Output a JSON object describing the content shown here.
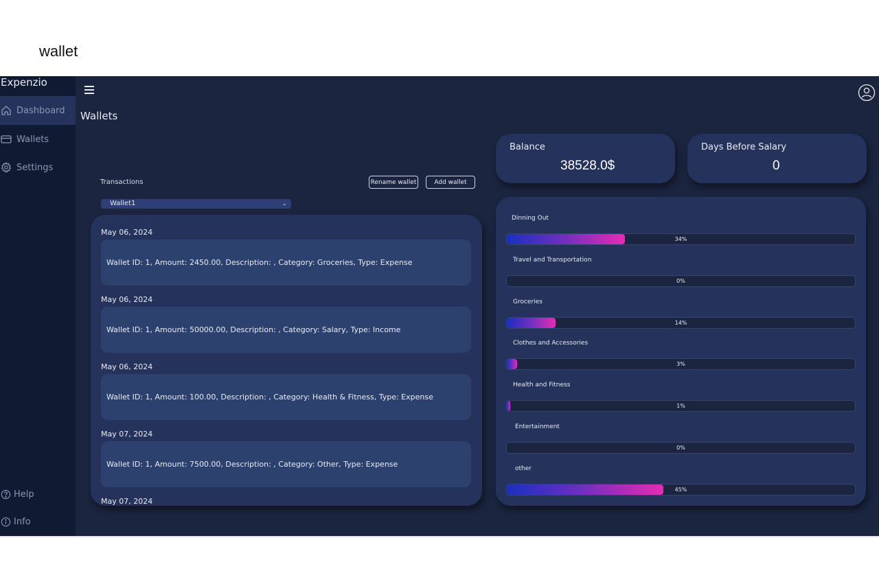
{
  "document": {
    "title": "wallet"
  },
  "app": {
    "brand": "Expenzio",
    "page_title": "Wallets"
  },
  "sidebar": {
    "items": [
      {
        "label": "Dashboard",
        "icon": "home-icon",
        "active": true
      },
      {
        "label": "Wallets",
        "icon": "wallet-icon",
        "active": false
      },
      {
        "label": "Settings",
        "icon": "gear-icon",
        "active": false
      }
    ],
    "footer": [
      {
        "label": "Help",
        "icon": "help-icon"
      },
      {
        "label": "Info",
        "icon": "info-icon"
      }
    ]
  },
  "transactions": {
    "label": "Transactions",
    "rename_button": "Rename wallet",
    "add_button": "Add wallet",
    "wallet_select": "Wallet1",
    "items": [
      {
        "date": "May 06, 2024",
        "text": "Wallet ID: 1, Amount: 2450.00, Description: , Category: Groceries, Type: Expense"
      },
      {
        "date": "May 06, 2024",
        "text": "Wallet ID: 1, Amount: 50000.00, Description: , Category: Salary, Type: Income"
      },
      {
        "date": "May 06, 2024",
        "text": "Wallet ID: 1, Amount: 100.00, Description: , Category: Health & Fitness, Type: Expense"
      },
      {
        "date": "May 07, 2024",
        "text": "Wallet ID: 1, Amount: 7500.00, Description: , Category: Other, Type: Expense"
      },
      {
        "date": "May 07, 2024",
        "text": ""
      }
    ]
  },
  "stats": {
    "balance": {
      "label": "Balance",
      "value": "38528.0$"
    },
    "days_before_salary": {
      "label": "Days Before Salary",
      "value": "0"
    }
  },
  "categories": [
    {
      "name": "Dinning Out",
      "percent": 34,
      "percent_label": "34%"
    },
    {
      "name": "Travel and Transportation",
      "percent": 0,
      "percent_label": "0%"
    },
    {
      "name": "Groceries",
      "percent": 14,
      "percent_label": "14%"
    },
    {
      "name": "Clothes and Accessories",
      "percent": 3,
      "percent_label": "3%"
    },
    {
      "name": "Health  and Fitness",
      "percent": 1,
      "percent_label": "1%"
    },
    {
      "name": "Entertainment",
      "percent": 0,
      "percent_label": "0%"
    },
    {
      "name": "other",
      "percent": 45,
      "percent_label": "45%"
    }
  ],
  "colors": {
    "app_bg": "#1b2540",
    "sidebar_bg": "#111a33",
    "panel_bg": "#25335c",
    "card_bg": "#2d416f",
    "gradient_start": "#1a2fbf",
    "gradient_end": "#e62bb4"
  }
}
